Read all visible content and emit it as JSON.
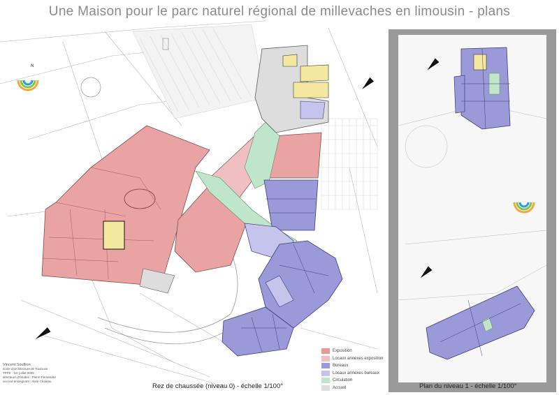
{
  "title": "Une Maison pour le parc naturel régional de millevaches en limousin - plans",
  "legend": [
    {
      "label": "Exposition",
      "color": "#e89a9a"
    },
    {
      "label": "Locaux annexes exposition",
      "color": "#f0c0c0"
    },
    {
      "label": "Bureaux",
      "color": "#9a9ad8"
    },
    {
      "label": "Locaux annexes bureaux",
      "color": "#c4c4ec"
    },
    {
      "label": "Circulation",
      "color": "#bfe6c8"
    },
    {
      "label": "Accueil",
      "color": "#dddddd"
    }
  ],
  "captions": {
    "ground": "Rez de chaussée (niveau 0) - échelle 1/100°",
    "level1": "Plan du niveau 1 - échelle 1/100°"
  },
  "credits": [
    "Vincent Souflion",
    "école d'architecture de Toulouse",
    "TPFE · 1er juillet 2005",
    "directeurs d'études : Pierre Fernandez",
    "second enseignant : Alain Chateau"
  ],
  "compass_label": "N",
  "colors": {
    "expo": "#e89a9a",
    "expo_annex": "#f0c0c0",
    "bureaux": "#9a9ad8",
    "bureaux_annex": "#c4c4ec",
    "circulation": "#bfe6c8",
    "accueil": "#dddddd",
    "yellow": "#f4e7a0"
  }
}
